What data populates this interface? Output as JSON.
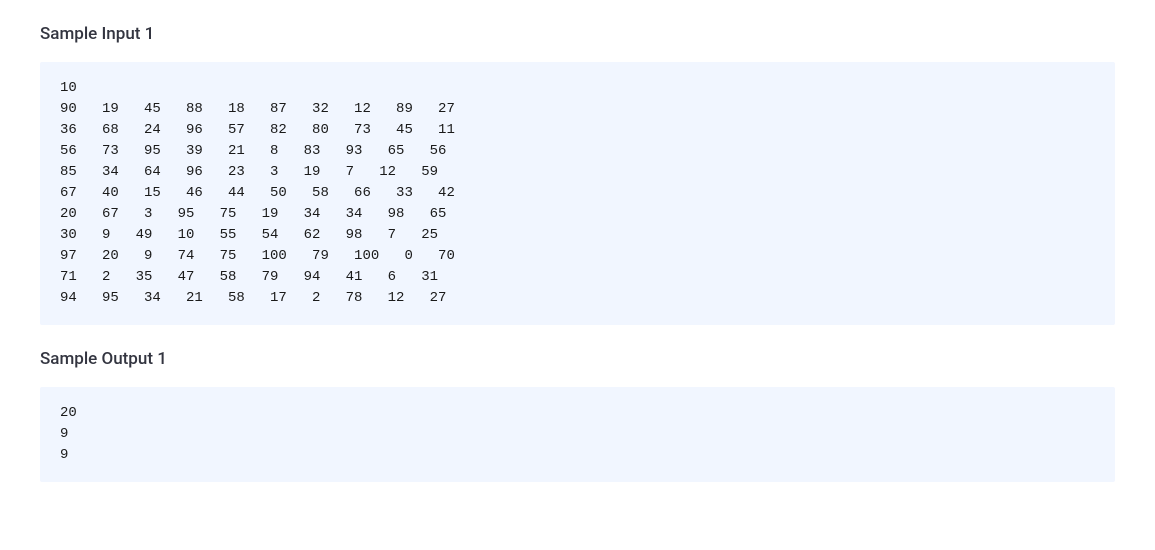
{
  "sections": [
    {
      "title": "Sample Input 1",
      "content": "10\n90   19   45   88   18   87   32   12   89   27\n36   68   24   96   57   82   80   73   45   11\n56   73   95   39   21   8   83   93   65   56\n85   34   64   96   23   3   19   7   12   59\n67   40   15   46   44   50   58   66   33   42\n20   67   3   95   75   19   34   34   98   65\n30   9   49   10   55   54   62   98   7   25\n97   20   9   74   75   100   79   100   0   70\n71   2   35   47   58   79   94   41   6   31\n94   95   34   21   58   17   2   78   12   27"
    },
    {
      "title": "Sample Output 1",
      "content": "20\n9\n9"
    }
  ]
}
